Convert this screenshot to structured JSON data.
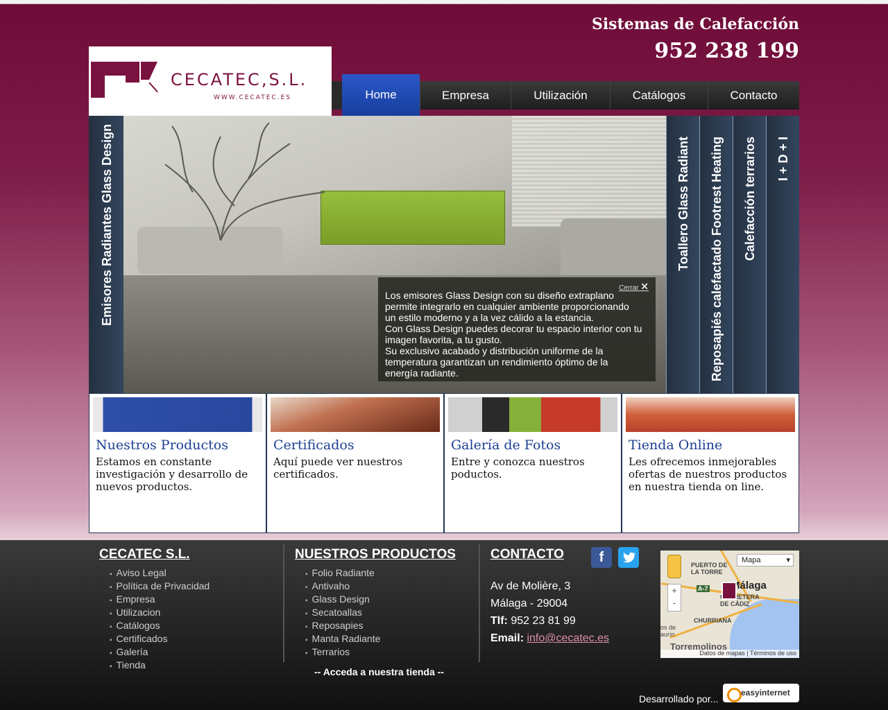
{
  "header": {
    "tagline": "Sistemas de Calefacción",
    "phone": "952 238 199",
    "logo_text": "CECATEC,S.L.",
    "logo_url": "WWW.CECATEC.ES"
  },
  "nav": {
    "items": [
      {
        "label": "Home",
        "active": true
      },
      {
        "label": "Empresa"
      },
      {
        "label": "Utilización"
      },
      {
        "label": "Catálogos"
      },
      {
        "label": "Contacto"
      }
    ]
  },
  "slider": {
    "left_tab": "Emisores Radiantes Glass Design",
    "right_tabs": [
      "Toallero Glass Radiant",
      "Reposapiés calefactado Footrest Heating",
      "Calefacción terrarios",
      "I + D + I"
    ],
    "caption_close": "Cerrar",
    "caption_lines": [
      "Los emisores Glass Design con su diseño extraplano",
      "permite integrarlo en cualquier ambiente proporcionando",
      "un estilo moderno y a la vez cálido a la estancia.",
      "Con Glass Design puedes decorar tu espacio interior con tu",
      "imagen favorita, a tu gusto.",
      "Su exclusivo acabado y distribución uniforme de la",
      "temperatura garantizan un rendimiento óptimo de la",
      "energía radiante."
    ]
  },
  "boxes": [
    {
      "title": "Nuestros Productos",
      "text": "Estamos en constante investigación y desarrollo de nuevos productos."
    },
    {
      "title": "Certificados",
      "text": "Aquí puede ver nuestros certificados."
    },
    {
      "title": "Galería de Fotos",
      "text": "Entre y conozca nuestros poductos."
    },
    {
      "title": "Tienda Online",
      "text": "Les ofrecemos inmejorables ofertas de nuestros productos en nuestra tienda on line."
    }
  ],
  "footer": {
    "col1": {
      "title": "CECATEC S.L.",
      "links": [
        "Aviso Legal",
        "Política de Privacidad",
        "Empresa",
        "Utilizacion",
        "Catálogos",
        "Certificados",
        "Galería",
        "Tienda"
      ]
    },
    "col2": {
      "title": "NUESTROS PRODUCTOS",
      "links": [
        "Folio Radiante",
        "Antivaho",
        "Glass Design",
        "Secatoallas",
        "Reposapies",
        "Manta Radiante",
        "Terrarios"
      ],
      "shop_link": "-- Acceda a nuestra tienda --"
    },
    "contact": {
      "title": "CONTACTO",
      "address": "Av de Molière, 3",
      "city": "Málaga - 29004",
      "phone_label": "Tlf:",
      "phone": "952 23 81 99",
      "email_label": "Email:",
      "email": "info@cecatec.es"
    },
    "map": {
      "type_select": "Mapa",
      "labels": [
        "PUERTO DE LA TORRE",
        "Málaga",
        "CARRETERA DE CÁDIZ",
        "CHURRIANA",
        "Torremolinos",
        "os de aurín",
        "A-7"
      ],
      "footer_links": [
        "Datos de mapas",
        "Términos de uso"
      ],
      "zoom_in": "+",
      "zoom_out": "-"
    },
    "developed_by": "Desarrollado por...",
    "developer": "easyinternet"
  },
  "colors": {
    "brand": "#7a1240",
    "nav_active": "#1f49b0",
    "box_title": "#1c3f91"
  }
}
